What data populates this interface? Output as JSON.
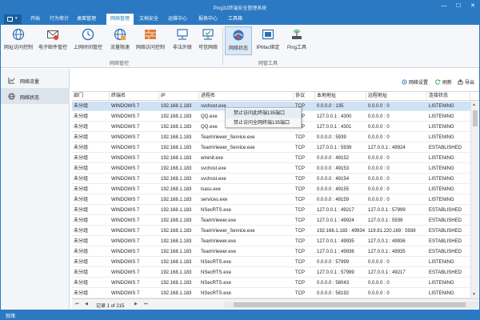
{
  "window": {
    "title": "Ping32终端安全管理系统",
    "min": "—",
    "max": "☐",
    "close": "✕"
  },
  "menu": [
    {
      "label": "开始"
    },
    {
      "label": "行为审计"
    },
    {
      "label": "桌面管理"
    },
    {
      "label": "网络管理",
      "active": true
    },
    {
      "label": "文档安全"
    },
    {
      "label": "运维中心"
    },
    {
      "label": "报表中心"
    },
    {
      "label": "工具箱"
    }
  ],
  "ribbon": {
    "buttons": [
      {
        "label": "网址访问控制",
        "icon": "globe-icon"
      },
      {
        "label": "电子邮件管控",
        "icon": "email-icon"
      },
      {
        "label": "上网时间管控",
        "icon": "clock-icon"
      },
      {
        "label": "流量限速",
        "icon": "globe-speed-icon"
      },
      {
        "label": "网络访问控制",
        "icon": "firewall-icon"
      },
      {
        "label": "非法外联",
        "icon": "network-person-icon"
      },
      {
        "label": "可信网络",
        "icon": "trusted-network-icon"
      },
      {
        "label": "网络状态",
        "icon": "network-status-icon",
        "selected": true
      },
      {
        "label": "IPMac绑定",
        "icon": "ipmac-icon"
      },
      {
        "label": "Ping工具",
        "icon": "ping-icon"
      }
    ],
    "groups": [
      {
        "label": "网络管控"
      },
      {
        "label": "网管工具"
      }
    ]
  },
  "leftnav": [
    {
      "label": "网络流量",
      "icon": "traffic-chart-icon"
    },
    {
      "label": "网络状态",
      "icon": "globe-icon",
      "selected": true
    }
  ],
  "toolbar": {
    "settings": "网络设置",
    "refresh": "刷新",
    "export": "导出"
  },
  "table": {
    "columns": [
      "部门",
      "终端名",
      "IP",
      "进程名",
      "协议",
      "本地地址",
      "远程地址",
      "连接状态"
    ],
    "rows": [
      [
        "未分组",
        "WINDOWS 7",
        "192.168.1.183",
        "svchost.exe",
        "TCP",
        "0.0.0.0 : 135",
        "0.0.0.0 : 0",
        "LISTENING"
      ],
      [
        "未分组",
        "WINDOWS 7",
        "192.168.1.183",
        "QQ.exe",
        "TCP",
        "127.0.0.1 : 4300",
        "0.0.0.0 : 0",
        "LISTENING"
      ],
      [
        "未分组",
        "WINDOWS 7",
        "192.168.1.183",
        "QQ.exe",
        "TCP",
        "127.0.0.1 : 4301",
        "0.0.0.0 : 0",
        "LISTENING"
      ],
      [
        "未分组",
        "WINDOWS 7",
        "192.168.1.183",
        "TeamViewer_Service.exe",
        "TCP",
        "0.0.0.0 : 5939",
        "0.0.0.0 : 0",
        "LISTENING"
      ],
      [
        "未分组",
        "WINDOWS 7",
        "192.168.1.183",
        "TeamViewer_Service.exe",
        "TCP",
        "127.0.0.1 : 5939",
        "127.0.0.1 : 49924",
        "ESTABLISHED"
      ],
      [
        "未分组",
        "WINDOWS 7",
        "192.168.1.183",
        "wininit.exe",
        "TCP",
        "0.0.0.0 : 49152",
        "0.0.0.0 : 0",
        "LISTENING"
      ],
      [
        "未分组",
        "WINDOWS 7",
        "192.168.1.183",
        "svchost.exe",
        "TCP",
        "0.0.0.0 : 49153",
        "0.0.0.0 : 0",
        "LISTENING"
      ],
      [
        "未分组",
        "WINDOWS 7",
        "192.168.1.183",
        "svchost.exe",
        "TCP",
        "0.0.0.0 : 49154",
        "0.0.0.0 : 0",
        "LISTENING"
      ],
      [
        "未分组",
        "WINDOWS 7",
        "192.168.1.183",
        "lsass.exe",
        "TCP",
        "0.0.0.0 : 49155",
        "0.0.0.0 : 0",
        "LISTENING"
      ],
      [
        "未分组",
        "WINDOWS 7",
        "192.168.1.183",
        "services.exe",
        "TCP",
        "0.0.0.0 : 49159",
        "0.0.0.0 : 0",
        "LISTENING"
      ],
      [
        "未分组",
        "WINDOWS 7",
        "192.168.1.183",
        "NSecRTS.exe",
        "TCP",
        "127.0.0.1 : 49217",
        "127.0.0.1 : 57999",
        "ESTABLISHED"
      ],
      [
        "未分组",
        "WINDOWS 7",
        "192.168.1.183",
        "TeamViewer.exe",
        "TCP",
        "127.0.0.1 : 49924",
        "127.0.0.1 : 5939",
        "ESTABLISHED"
      ],
      [
        "未分组",
        "WINDOWS 7",
        "192.168.1.183",
        "TeamViewer_Service.exe",
        "TCP",
        "192.168.1.183 : 49934",
        "119.81.220.169 : 5938",
        "ESTABLISHED"
      ],
      [
        "未分组",
        "WINDOWS 7",
        "192.168.1.183",
        "TeamViewer.exe",
        "TCP",
        "127.0.0.1 : 49935",
        "127.0.0.1 : 49936",
        "ESTABLISHED"
      ],
      [
        "未分组",
        "WINDOWS 7",
        "192.168.1.183",
        "TeamViewer.exe",
        "TCP",
        "127.0.0.1 : 49936",
        "127.0.0.1 : 49935",
        "ESTABLISHED"
      ],
      [
        "未分组",
        "WINDOWS 7",
        "192.168.1.183",
        "NSecRTS.exe",
        "TCP",
        "0.0.0.0 : 57999",
        "0.0.0.0 : 0",
        "LISTENING"
      ],
      [
        "未分组",
        "WINDOWS 7",
        "192.168.1.183",
        "NSecRTS.exe",
        "TCP",
        "127.0.0.1 : 57999",
        "127.0.0.1 : 49217",
        "ESTABLISHED"
      ],
      [
        "未分组",
        "WINDOWS 7",
        "192.168.1.183",
        "NSecRTS.exe",
        "TCP",
        "0.0.0.0 : 58043",
        "0.0.0.0 : 0",
        "LISTENING"
      ],
      [
        "未分组",
        "WINDOWS 7",
        "192.168.1.183",
        "NSecRTS.exe",
        "TCP",
        "0.0.0.0 : 58192",
        "0.0.0.0 : 0",
        "LISTENING"
      ]
    ]
  },
  "context_menu": [
    {
      "label": "禁止访问此终端135端口"
    },
    {
      "label": "禁止访问全网终端135端口"
    }
  ],
  "pager": {
    "text": "记录 1 of 215",
    "first": "⏮",
    "prev": "◀",
    "next": "▶",
    "last": "⏭"
  },
  "status": "就绪",
  "colors": {
    "accent": "#2b79c2",
    "selection": "#cfe2f6"
  }
}
